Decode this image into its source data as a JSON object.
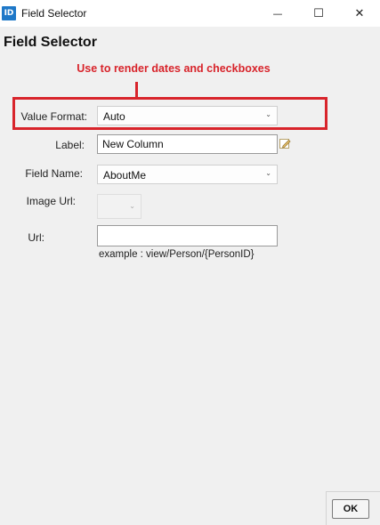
{
  "window": {
    "title": "Field Selector",
    "icon_text": "ID",
    "minimize_glyph": "—",
    "maximize_glyph": "☐",
    "close_glyph": "✕"
  },
  "page_title": "Field Selector",
  "annotation": {
    "text": "Use to render dates and checkboxes",
    "color": "#d8242b"
  },
  "form": {
    "value_format": {
      "label": "Value Format:",
      "value": "Auto"
    },
    "label_field": {
      "label": "Label:",
      "value": "New Column"
    },
    "field_name": {
      "label": "Field Name:",
      "value": "AboutMe"
    },
    "image_url": {
      "label": "Image Url:",
      "value": ""
    },
    "url": {
      "label": "Url:",
      "value": "",
      "hint": "example : view/Person/{PersonID}"
    }
  },
  "footer": {
    "ok_label": "OK"
  },
  "icons": {
    "dropdown": "chevron-down-icon",
    "edit": "pencil-icon"
  }
}
